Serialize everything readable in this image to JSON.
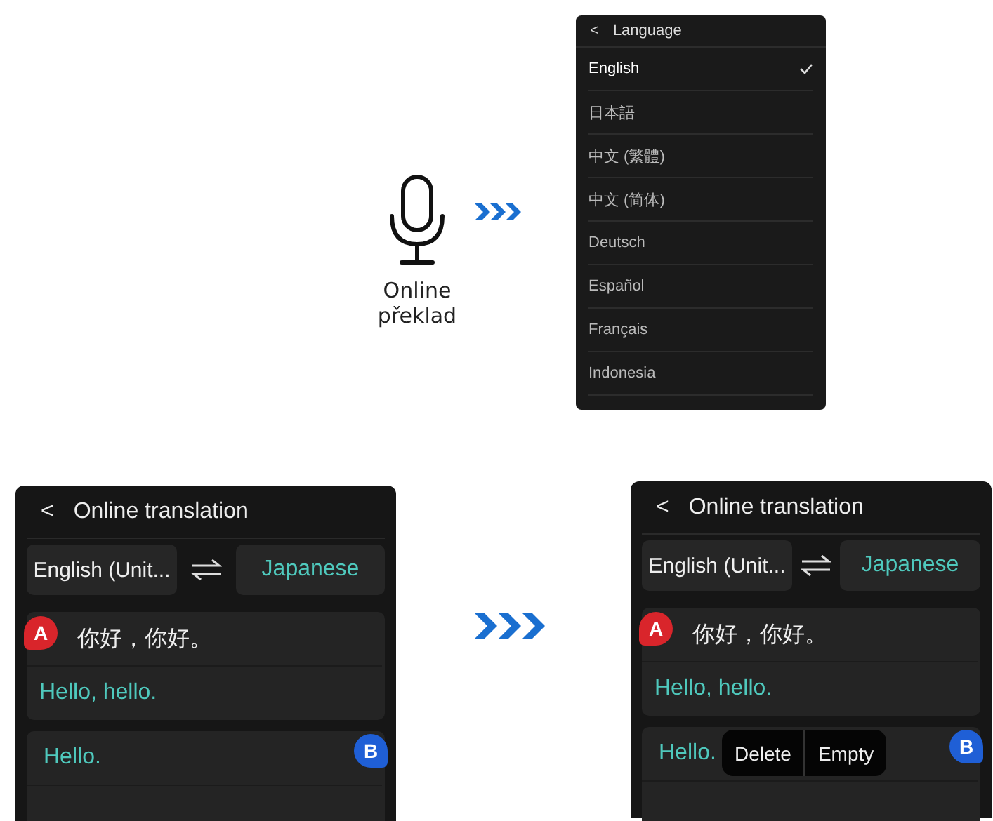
{
  "mic_label": "Online překlad",
  "language_menu": {
    "back": "<",
    "title": "Language",
    "items": [
      {
        "label": "English",
        "selected": true
      },
      {
        "label": "日本語",
        "selected": false
      },
      {
        "label": "中文 (繁體)",
        "selected": false
      },
      {
        "label": "中文 (简体)",
        "selected": false
      },
      {
        "label": "Deutsch",
        "selected": false
      },
      {
        "label": "Español",
        "selected": false
      },
      {
        "label": "Français",
        "selected": false
      },
      {
        "label": "Indonesia",
        "selected": false
      }
    ]
  },
  "phones": [
    {
      "back": "<",
      "title": "Online translation",
      "source_language": "English (Unit...",
      "target_language": "Japanese",
      "messages": [
        {
          "speaker": "A",
          "color": "#d9252b",
          "kind": "left",
          "original": "你好，你好。",
          "translation": "Hello, hello."
        },
        {
          "speaker": "B",
          "color": "#1f5fd6",
          "kind": "right",
          "translation": "Hello."
        }
      ]
    },
    {
      "back": "<",
      "title": "Online translation",
      "source_language": "English (Unit...",
      "target_language": "Japanese",
      "messages": [
        {
          "speaker": "A",
          "color": "#d9252b",
          "kind": "left",
          "original": "你好，你好。",
          "translation": "Hello, hello."
        },
        {
          "speaker": "B",
          "color": "#1f5fd6",
          "kind": "right",
          "translation": "Hello."
        }
      ],
      "context_menu": [
        "Delete",
        "Empty"
      ]
    }
  ]
}
